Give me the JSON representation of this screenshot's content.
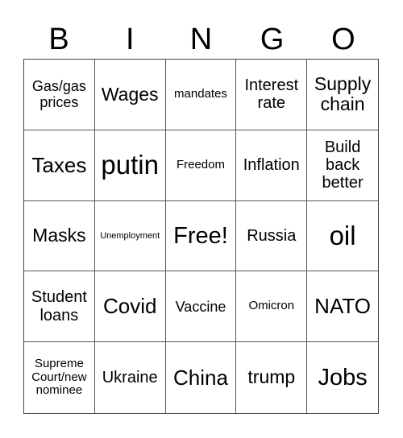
{
  "header": {
    "letters": [
      "B",
      "I",
      "N",
      "G",
      "O"
    ]
  },
  "cells": [
    "Gas/gas prices",
    "Wages",
    "mandates",
    "Interest rate",
    "Supply chain",
    "Taxes",
    "putin",
    "Freedom",
    "Inflation",
    "Build back better",
    "Masks",
    "Unemployment",
    "Free!",
    "Russia",
    "oil",
    "Student loans",
    "Covid",
    "Vaccine",
    "Omicron",
    "NATO",
    "Supreme Court/new nominee",
    "Ukraine",
    "China",
    "trump",
    "Jobs"
  ]
}
